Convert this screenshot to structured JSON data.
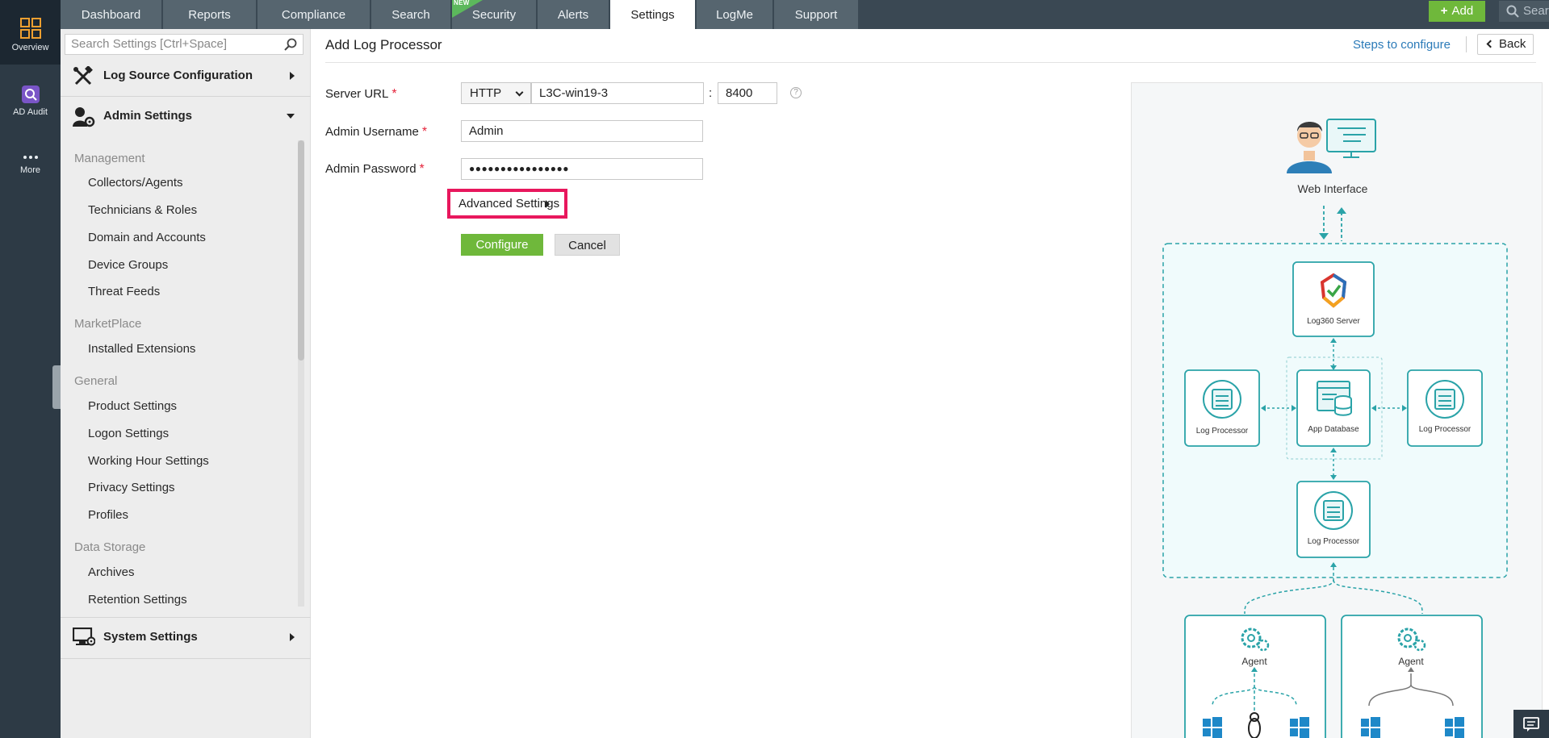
{
  "rail": {
    "items": [
      {
        "label": "Overview",
        "icon": "grid-icon"
      },
      {
        "label": "AD Audit",
        "icon": "ad-audit-icon"
      },
      {
        "label": "More",
        "icon": "more-dots-icon"
      }
    ]
  },
  "topnav": {
    "tabs": [
      {
        "label": "Dashboard"
      },
      {
        "label": "Reports"
      },
      {
        "label": "Compliance"
      },
      {
        "label": "Search"
      },
      {
        "label": "Security",
        "badge": "NEW"
      },
      {
        "label": "Alerts"
      },
      {
        "label": "Settings",
        "active": true
      },
      {
        "label": "LogMe"
      },
      {
        "label": "Support"
      }
    ],
    "add_label": "Add",
    "search_placeholder": "Search"
  },
  "sidebar": {
    "search_placeholder": "Search Settings [Ctrl+Space]",
    "sections": [
      {
        "label": "Log Source Configuration",
        "expanded": false
      },
      {
        "label": "Admin Settings",
        "expanded": true
      },
      {
        "label": "System Settings",
        "expanded": false
      }
    ],
    "groups": [
      {
        "label": "Management",
        "items": [
          "Collectors/Agents",
          "Technicians & Roles",
          "Domain and Accounts",
          "Device Groups",
          "Threat Feeds"
        ]
      },
      {
        "label": "MarketPlace",
        "items": [
          "Installed Extensions"
        ]
      },
      {
        "label": "General",
        "items": [
          "Product Settings",
          "Logon Settings",
          "Working Hour Settings",
          "Privacy Settings",
          "Profiles"
        ]
      },
      {
        "label": "Data Storage",
        "items": [
          "Archives",
          "Retention Settings"
        ]
      }
    ]
  },
  "main": {
    "title": "Add Log Processor",
    "steps_link": "Steps to configure",
    "back_label": "Back",
    "form": {
      "server_url_label": "Server URL",
      "protocol": "HTTP",
      "host": "L3C-win19-3",
      "colon": ":",
      "port": "8400",
      "help": "?",
      "username_label": "Admin Username",
      "username": "Admin",
      "password_label": "Admin Password",
      "password_masked": "●●●●●●●●●●●●●●●●",
      "required_mark": "*",
      "advanced_label": "Advanced Settings",
      "configure_label": "Configure",
      "cancel_label": "Cancel"
    }
  },
  "diagram": {
    "web_interface": "Web Interface",
    "server": "Log360 Server",
    "app_db": "App Database",
    "log_processor": "Log Processor",
    "agent": "Agent"
  },
  "colors": {
    "accent_green": "#6fb83b",
    "highlight_pink": "#e8175d",
    "teal": "#2aa3a8",
    "nav_dark": "#2d3a45"
  }
}
